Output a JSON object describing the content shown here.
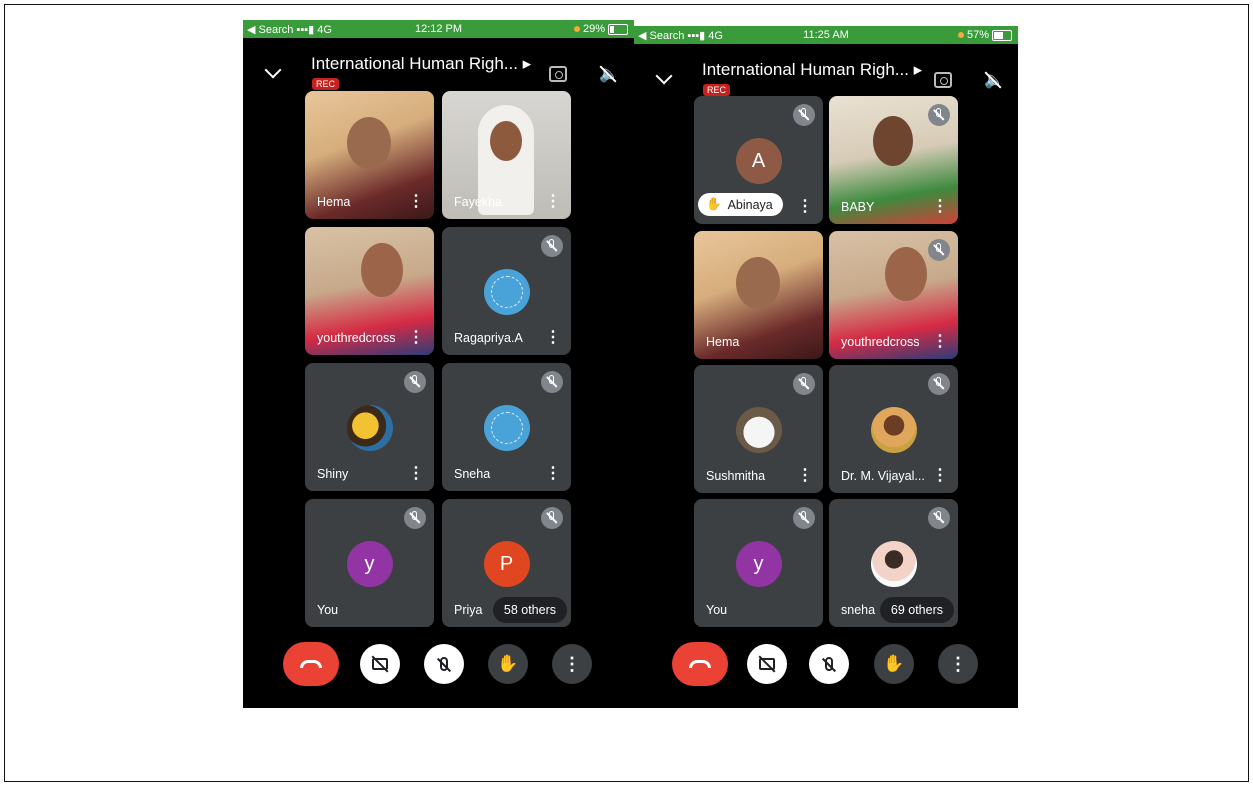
{
  "phones": [
    {
      "status": {
        "left": "◀ Search ▪▪▪▮ 4G",
        "time": "12:12 PM",
        "battery": "29%"
      },
      "meeting_title": "International Human Righ... ▸",
      "rec_badge": "REC",
      "participants": [
        "Hema",
        "Fayekha",
        "youthredcross",
        "Ragapriya.A",
        "Shiny",
        "Sneha",
        "You",
        "Priya"
      ],
      "avatars": {
        "you": "y",
        "priya": "P"
      },
      "others": "58 others"
    },
    {
      "status": {
        "left": "◀ Search ▪▪▪▮ 4G",
        "time": "11:25 AM",
        "battery": "57%"
      },
      "meeting_title": "International Human Righ... ▸",
      "rec_badge": "REC",
      "participants": [
        "Abinaya",
        "BABY",
        "Hema",
        "youthredcross",
        "Sushmitha",
        "Dr. M. Vijayal...",
        "You",
        "sneha"
      ],
      "avatars": {
        "abinaya": "A",
        "you": "y"
      },
      "others": "69 others"
    }
  ],
  "icons": {
    "more": "⋮",
    "hand": "✋",
    "kebab": "⋮"
  }
}
